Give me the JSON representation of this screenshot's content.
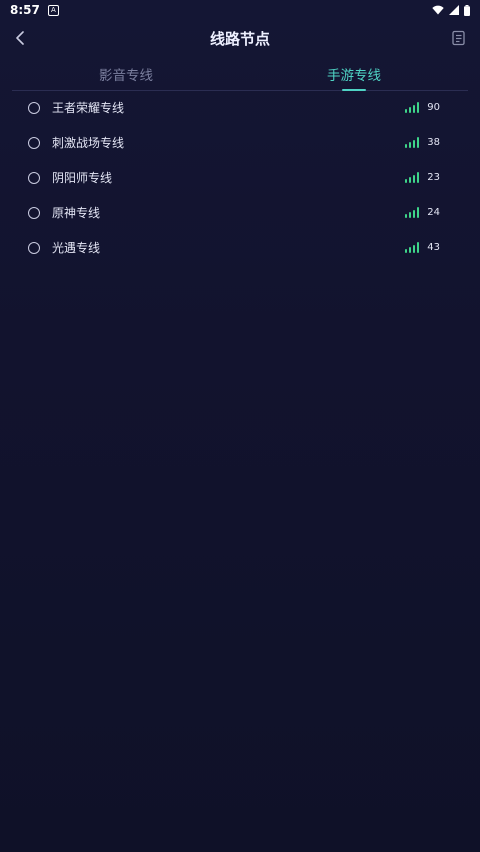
{
  "status_bar": {
    "time": "8:57",
    "notification_glyph": "A"
  },
  "header": {
    "title": "线路节点"
  },
  "tabs": [
    {
      "label": "影音专线",
      "active": false
    },
    {
      "label": "手游专线",
      "active": true
    }
  ],
  "nodes": [
    {
      "name": "王者荣耀专线",
      "ping": "90",
      "selected": false
    },
    {
      "name": "刺激战场专线",
      "ping": "38",
      "selected": false
    },
    {
      "name": "阴阳师专线",
      "ping": "23",
      "selected": false
    },
    {
      "name": "原神专线",
      "ping": "24",
      "selected": false
    },
    {
      "name": "光遇专线",
      "ping": "43",
      "selected": false
    }
  ],
  "colors": {
    "accent": "#4fd3c4",
    "signal": "#3ed58a",
    "background": "#12132e"
  },
  "icons": {
    "back": "chevron-left-icon",
    "menu": "document-list-icon",
    "wifi": "wifi-icon",
    "cell": "cellular-signal-icon",
    "battery": "battery-icon"
  }
}
